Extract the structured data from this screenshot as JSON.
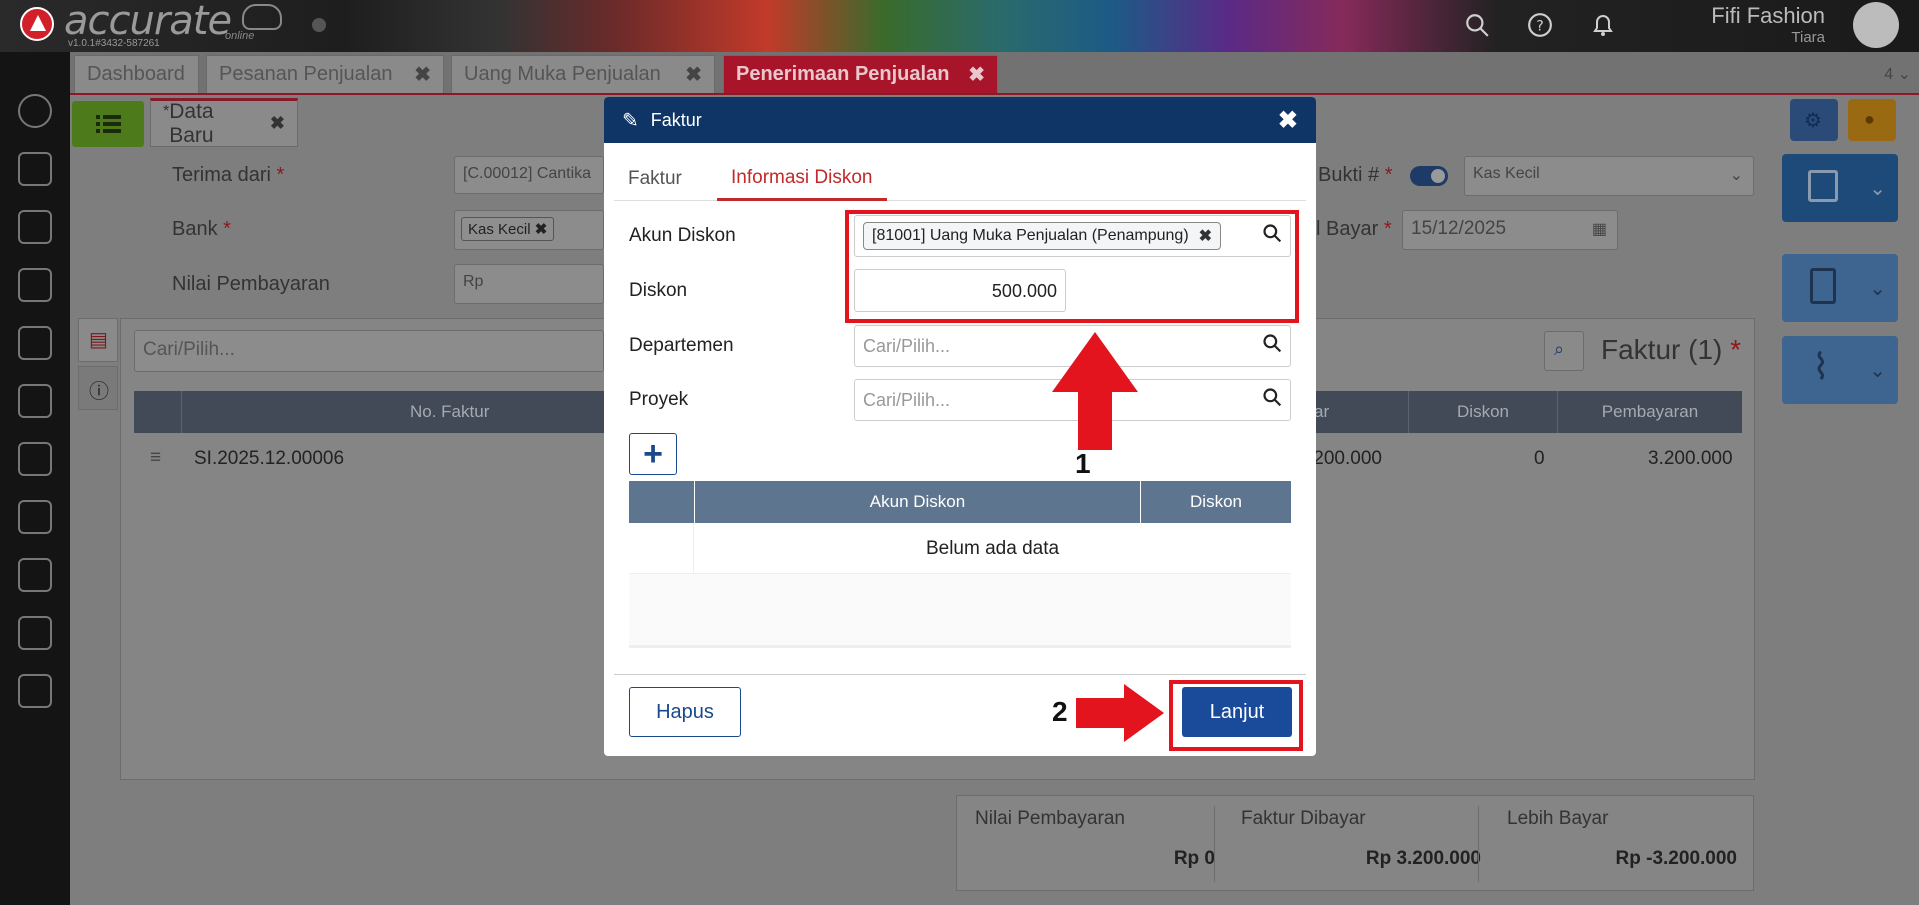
{
  "app": {
    "logo_text": "accurate",
    "logo_sub": "online",
    "version": "v1.0.1#3432-587261",
    "company_name": "Fifi Fashion",
    "user_name": "Tiara"
  },
  "tabs": [
    {
      "label": "Dashboard"
    },
    {
      "label": "Pesanan Penjualan",
      "close": "✖"
    },
    {
      "label": "Uang Muka Penjualan",
      "close": "✖"
    },
    {
      "label": "Penerimaan Penjualan",
      "close": "✖"
    }
  ],
  "tab_count": "4",
  "doc_tab": {
    "marker": "*",
    "label": "Data Baru",
    "close": "✖"
  },
  "form": {
    "terima_dari_label": "Terima dari",
    "terima_dari_value": "[C.00012] Cantika",
    "bank_label": "Bank",
    "bank_value": "Kas Kecil",
    "nilai_label": "Nilai Pembayaran",
    "nilai_placeholder": "Rp",
    "bukti_label": "Bukti #",
    "bukti_value": "Kas Kecil",
    "tgl_label": "l Bayar",
    "tgl_value": "15/12/2025",
    "required_mark": "*"
  },
  "invoice_panel": {
    "search_placeholder": "Cari/Pilih...",
    "title": "Faktur (1)",
    "columns": [
      "No. Faktur",
      "ar",
      "Diskon",
      "Pembayaran"
    ],
    "row": {
      "no_faktur": "SI.2025.12.00006",
      "bayar": ".200.000",
      "diskon": "0",
      "pembayaran": "3.200.000"
    }
  },
  "summary": {
    "nilai_label": "Nilai Pembayaran",
    "nilai_value": "Rp 0",
    "dibayar_label": "Faktur Dibayar",
    "dibayar_value": "Rp 3.200.000",
    "lebih_label": "Lebih Bayar",
    "lebih_value": "Rp -3.200.000"
  },
  "modal": {
    "title": "Faktur",
    "close": "✖",
    "tabs": [
      {
        "label": "Faktur"
      },
      {
        "label": "Informasi Diskon"
      }
    ],
    "akun_diskon_label": "Akun Diskon",
    "akun_diskon_value": "[81001] Uang Muka Penjualan (Penampung)",
    "chip_remove": "✖",
    "diskon_label": "Diskon",
    "diskon_value": "500.000",
    "departemen_label": "Departemen",
    "departemen_placeholder": "Cari/Pilih...",
    "proyek_label": "Proyek",
    "proyek_placeholder": "Cari/Pilih...",
    "add_label": "+",
    "table_columns": [
      "Akun Diskon",
      "Diskon"
    ],
    "empty_text": "Belum ada data",
    "hapus_label": "Hapus",
    "lanjut_label": "Lanjut"
  },
  "annotations": {
    "label_1": "1",
    "label_2": "2"
  },
  "colors": {
    "brand_navy": "#0f3566",
    "accent_red": "#c12a2a",
    "annotation_red": "#e3141e",
    "button_blue": "#1a4a9a"
  },
  "icons": [
    "search-icon",
    "help-icon",
    "bell-icon",
    "gear-icon",
    "pencil-icon",
    "close-icon",
    "calendar-icon",
    "save-icon",
    "document-icon",
    "paperclip-icon",
    "lightbulb-icon",
    "list-icon",
    "info-icon",
    "chevron-down-icon",
    "arrow-up-icon",
    "arrow-right-icon"
  ]
}
